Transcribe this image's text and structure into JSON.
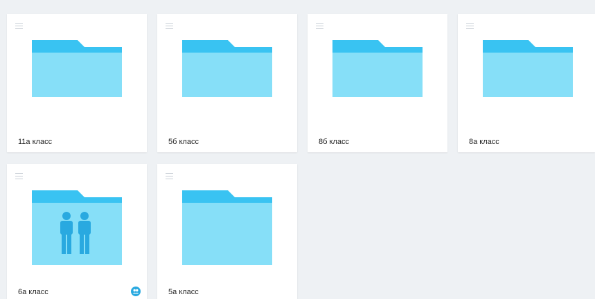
{
  "folders": [
    {
      "label": "11а класс",
      "shared": false
    },
    {
      "label": "5б класс",
      "shared": false
    },
    {
      "label": "8б класс",
      "shared": false
    },
    {
      "label": "8а класс",
      "shared": false
    },
    {
      "label": "6а класс",
      "shared": true
    },
    {
      "label": "5а класс",
      "shared": false
    }
  ],
  "colors": {
    "background": "#eef1f4",
    "card": "#ffffff",
    "folder_tab": "#39c3f2",
    "folder_body": "#86dff8",
    "people_icon": "#29a9e0",
    "badge": "#29a9e0"
  },
  "icons": {
    "drag_handle": "drag-handle-icon",
    "folder": "folder-icon",
    "shared_folder_people": "people-icon",
    "shared_badge": "shared-users-icon"
  }
}
